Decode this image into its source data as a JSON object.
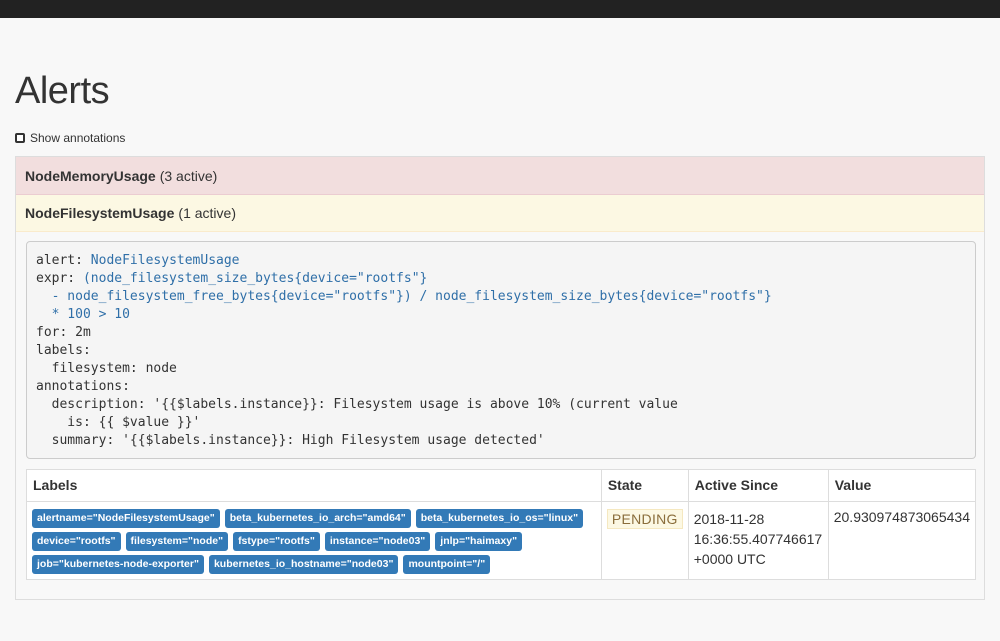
{
  "page": {
    "title": "Alerts"
  },
  "toggle": {
    "label": "Show annotations"
  },
  "groups": [
    {
      "name": "NodeMemoryUsage",
      "count": "(3 active)"
    },
    {
      "name": "NodeFilesystemUsage",
      "count": "(1 active)"
    }
  ],
  "rule": {
    "lines": [
      [
        {
          "t": "alert: ",
          "c": "k"
        },
        {
          "t": "NodeFilesystemUsage",
          "c": "v"
        }
      ],
      [
        {
          "t": "expr: ",
          "c": "k"
        },
        {
          "t": "(node_filesystem_size_bytes{device=\"rootfs\"}",
          "c": "v"
        }
      ],
      [
        {
          "t": "  - node_filesystem_free_bytes{device=\"rootfs\"}) / node_filesystem_size_bytes{device=\"rootfs\"}",
          "c": "v"
        }
      ],
      [
        {
          "t": "  * 100 > 10",
          "c": "v"
        }
      ],
      [
        {
          "t": "for: 2m",
          "c": "k"
        }
      ],
      [
        {
          "t": "labels:",
          "c": "k"
        }
      ],
      [
        {
          "t": "  filesystem: node",
          "c": "k"
        }
      ],
      [
        {
          "t": "annotations:",
          "c": "k"
        }
      ],
      [
        {
          "t": "  description: '{{$labels.instance}}: Filesystem usage is above 10% (current value",
          "c": "k"
        }
      ],
      [
        {
          "t": "    is: {{ $value }}'",
          "c": "k"
        }
      ],
      [
        {
          "t": "  summary: '{{$labels.instance}}: High Filesystem usage detected'",
          "c": "k"
        }
      ]
    ]
  },
  "table": {
    "headers": {
      "labels": "Labels",
      "state": "State",
      "since": "Active Since",
      "value": "Value"
    },
    "rows": [
      {
        "labels": [
          "alertname=\"NodeFilesystemUsage\"",
          "beta_kubernetes_io_arch=\"amd64\"",
          "beta_kubernetes_io_os=\"linux\"",
          "device=\"rootfs\"",
          "filesystem=\"node\"",
          "fstype=\"rootfs\"",
          "instance=\"node03\"",
          "jnlp=\"haimaxy\"",
          "job=\"kubernetes-node-exporter\"",
          "kubernetes_io_hostname=\"node03\"",
          "mountpoint=\"/\""
        ],
        "state": "PENDING",
        "since": [
          "2018-11-28",
          "16:36:55.407746617",
          "+0000 UTC"
        ],
        "value": "20.930974873065434"
      }
    ]
  },
  "colors": {
    "danger_bg": "#f2dede",
    "warning_bg": "#fcf8e3",
    "label_blue": "#337ab7",
    "code_blue": "#2f6fa8"
  }
}
